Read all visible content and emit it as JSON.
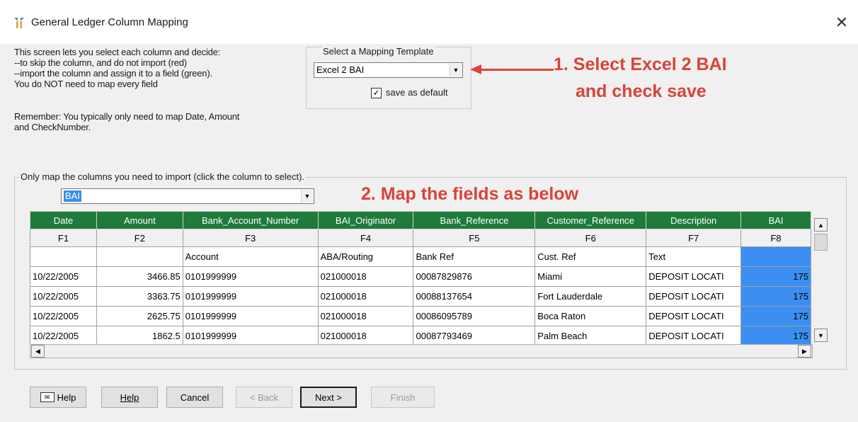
{
  "window": {
    "title": "General Ledger Column Mapping",
    "close_glyph": "✕"
  },
  "intro": {
    "lines": [
      "This screen lets you select each column and decide:",
      "--to skip the column, and do not import (red)",
      "--import the column and assign it to a field (green).",
      "You do NOT need to map every field"
    ],
    "remember_line1": "Remember:  You typically only need to map Date, Amount",
    "remember_line2": "and CheckNumber."
  },
  "template": {
    "legend": "Select a Mapping Template",
    "selected": "Excel 2 BAI",
    "save_default_label": "save as default",
    "save_default_checked": true
  },
  "annotations": {
    "step1_line1": "1. Select Excel 2 BAI",
    "step1_line2": "and check save",
    "step2": "2. Map the fields as below",
    "color": "#d9433a"
  },
  "mapping": {
    "legend": "Only map the columns you need to import (click the column to select).",
    "field_select_value": "BAI",
    "columns": [
      {
        "field": "Date",
        "id": "F1"
      },
      {
        "field": "Amount",
        "id": "F2"
      },
      {
        "field": "Bank_Account_Number",
        "id": "F3"
      },
      {
        "field": "BAI_Originator",
        "id": "F4"
      },
      {
        "field": "Bank_Reference",
        "id": "F5"
      },
      {
        "field": "Customer_Reference",
        "id": "F6"
      },
      {
        "field": "Description",
        "id": "F7"
      },
      {
        "field": "BAI",
        "id": "F8"
      }
    ],
    "header_row": [
      "",
      "",
      "Account",
      "ABA/Routing",
      "Bank Ref",
      "Cust. Ref",
      "Text",
      ""
    ],
    "rows": [
      [
        "10/22/2005",
        "3466.85",
        "0101999999",
        "021000018",
        "00087829876",
        "Miami",
        "DEPOSIT LOCATI",
        "175"
      ],
      [
        "10/22/2005",
        "3363.75",
        "0101999999",
        "021000018",
        "00088137654",
        "Fort Lauderdale",
        "DEPOSIT LOCATI",
        "175"
      ],
      [
        "10/22/2005",
        "2625.75",
        "0101999999",
        "021000018",
        "00086095789",
        "Boca Raton",
        "DEPOSIT LOCATI",
        "175"
      ],
      [
        "10/22/2005",
        "1862.5",
        "0101999999",
        "021000018",
        "00087793469",
        "Palm Beach",
        "DEPOSIT LOCATI",
        "175"
      ]
    ],
    "mapped_color": "#1e7b3a",
    "selected_column_color": "#3b8ff0"
  },
  "buttons": {
    "help_icon": "Help",
    "help": "Help",
    "cancel": "Cancel",
    "back": "< Back",
    "next": "Next >",
    "finish": "Finish"
  }
}
